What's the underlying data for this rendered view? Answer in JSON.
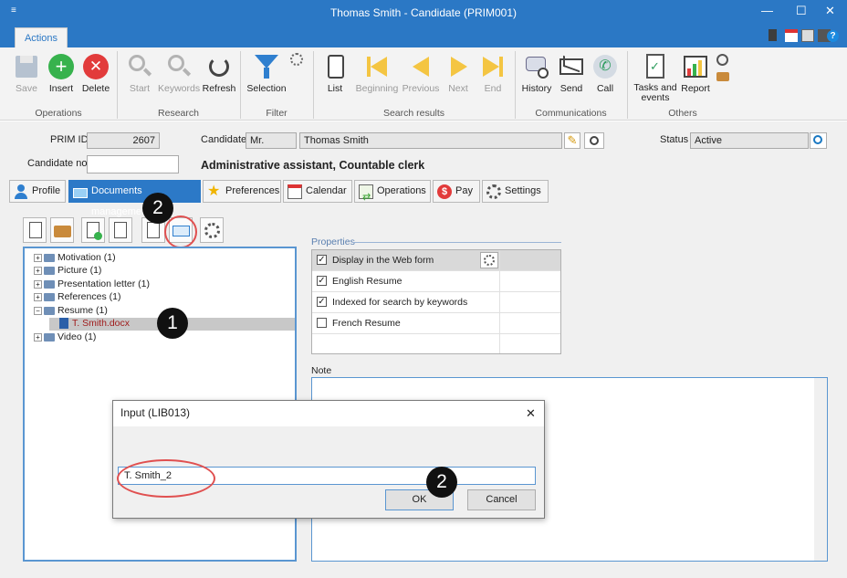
{
  "window": {
    "title": "Thomas Smith - Candidate (PRIM001)",
    "system_glyph": "≡",
    "minimize": "—",
    "maximize": "☐",
    "close": "✕"
  },
  "ribbon_tab": "Actions",
  "quick_access_help": "?",
  "ribbon": {
    "buttons": {
      "save": "Save",
      "insert": "Insert",
      "delete": "Delete",
      "start": "Start",
      "keywords": "Keywords",
      "refresh": "Refresh",
      "selection": "Selection",
      "list": "List",
      "beginning": "Beginning",
      "previous": "Previous",
      "next": "Next",
      "end": "End",
      "history": "History",
      "send": "Send",
      "call": "Call",
      "tasks_line1": "Tasks and",
      "tasks_line2": "events",
      "report": "Report"
    },
    "groups": {
      "operations": "Operations",
      "research": "Research",
      "filter": "Filter",
      "search_results": "Search results",
      "communications": "Communications",
      "others": "Others"
    }
  },
  "form": {
    "prim_id_label": "PRIM ID",
    "prim_id_value": "2607",
    "candidate_label": "Candidate",
    "title_value": "Mr.",
    "name_value": "Thomas Smith",
    "status_label": "Status",
    "status_value": "Active",
    "candidate_no_label": "Candidate no.",
    "candidate_no_value": "",
    "job_title": "Administrative assistant, Countable clerk"
  },
  "tabs": [
    {
      "label": "Profile"
    },
    {
      "label": "Documents management"
    },
    {
      "label": "Preferences"
    },
    {
      "label": "Calendar"
    },
    {
      "label": "Operations"
    },
    {
      "label": "Pay"
    },
    {
      "label": "Settings"
    }
  ],
  "tree": {
    "expanded_sign": "−",
    "collapsed_sign": "+",
    "nodes": [
      {
        "label": "Motivation (1)"
      },
      {
        "label": "Picture (1)"
      },
      {
        "label": "Presentation letter (1)"
      },
      {
        "label": "References (1)"
      },
      {
        "label": "Resume (1)"
      },
      {
        "label": "T. Smith.docx"
      },
      {
        "label": "Video (1)"
      }
    ]
  },
  "properties": {
    "title": "Properties",
    "check_mark": "✓",
    "rows": [
      {
        "label": "Display in the Web form",
        "checked": true
      },
      {
        "label": "English Resume",
        "checked": true
      },
      {
        "label": "Indexed for search by keywords",
        "checked": true
      },
      {
        "label": "French Resume",
        "checked": false
      }
    ]
  },
  "note": {
    "label": "Note",
    "value": ""
  },
  "dialog": {
    "title": "Input (LIB013)",
    "close": "✕",
    "input_value": "T. Smith_2",
    "ok": "OK",
    "cancel": "Cancel"
  },
  "callouts": {
    "one": "1",
    "two": "2"
  }
}
